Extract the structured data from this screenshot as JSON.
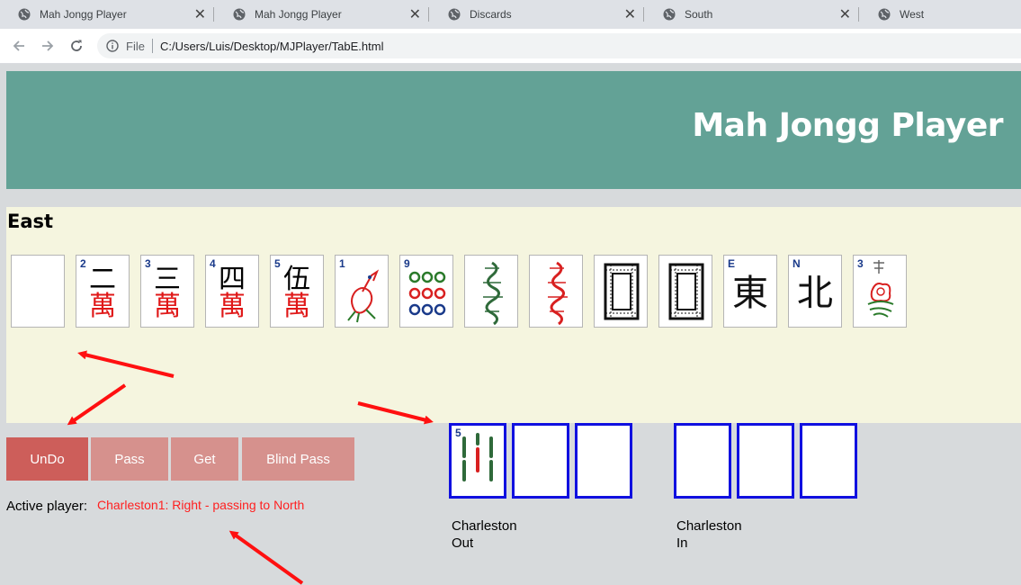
{
  "browser": {
    "tabs": [
      {
        "title": "Mah Jongg Player"
      },
      {
        "title": "Mah Jongg Player"
      },
      {
        "title": "Discards"
      },
      {
        "title": "South"
      },
      {
        "title": "West"
      }
    ],
    "address": {
      "scheme": "File",
      "url": "C:/Users/Luis/Desktop/MJPlayer/TabE.html"
    }
  },
  "page": {
    "title": "Mah Jongg Player",
    "player_name": "East",
    "hand": [
      {
        "num": "",
        "top": "",
        "bottom": ""
      },
      {
        "num": "2",
        "top": "二",
        "bottom": "萬"
      },
      {
        "num": "3",
        "top": "三",
        "bottom": "萬"
      },
      {
        "num": "4",
        "top": "四",
        "bottom": "萬"
      },
      {
        "num": "5",
        "top": "伍",
        "bottom": "萬"
      },
      {
        "num": "1",
        "top": "",
        "bottom": ""
      },
      {
        "num": "9",
        "top": "",
        "bottom": ""
      },
      {
        "num": "",
        "top": "",
        "bottom": ""
      },
      {
        "num": "",
        "top": "",
        "bottom": ""
      },
      {
        "num": "",
        "top": "",
        "bottom": ""
      },
      {
        "num": "",
        "top": "",
        "bottom": ""
      },
      {
        "num": "E",
        "top": "東",
        "bottom": ""
      },
      {
        "num": "N",
        "top": "北",
        "bottom": ""
      },
      {
        "num": "3",
        "top": "",
        "bottom": ""
      }
    ],
    "buttons": {
      "undo": "UnDo",
      "pass": "Pass",
      "get": "Get",
      "blind_pass": "Blind Pass"
    },
    "active_player_label": "Active player:",
    "status": "Charleston1:  Right - passing to North",
    "charleston_out": {
      "label_line1": "Charleston",
      "label_line2": "Out",
      "first_tile_num": "5"
    },
    "charleston_in": {
      "label_line1": "Charleston",
      "label_line2": "In"
    }
  }
}
